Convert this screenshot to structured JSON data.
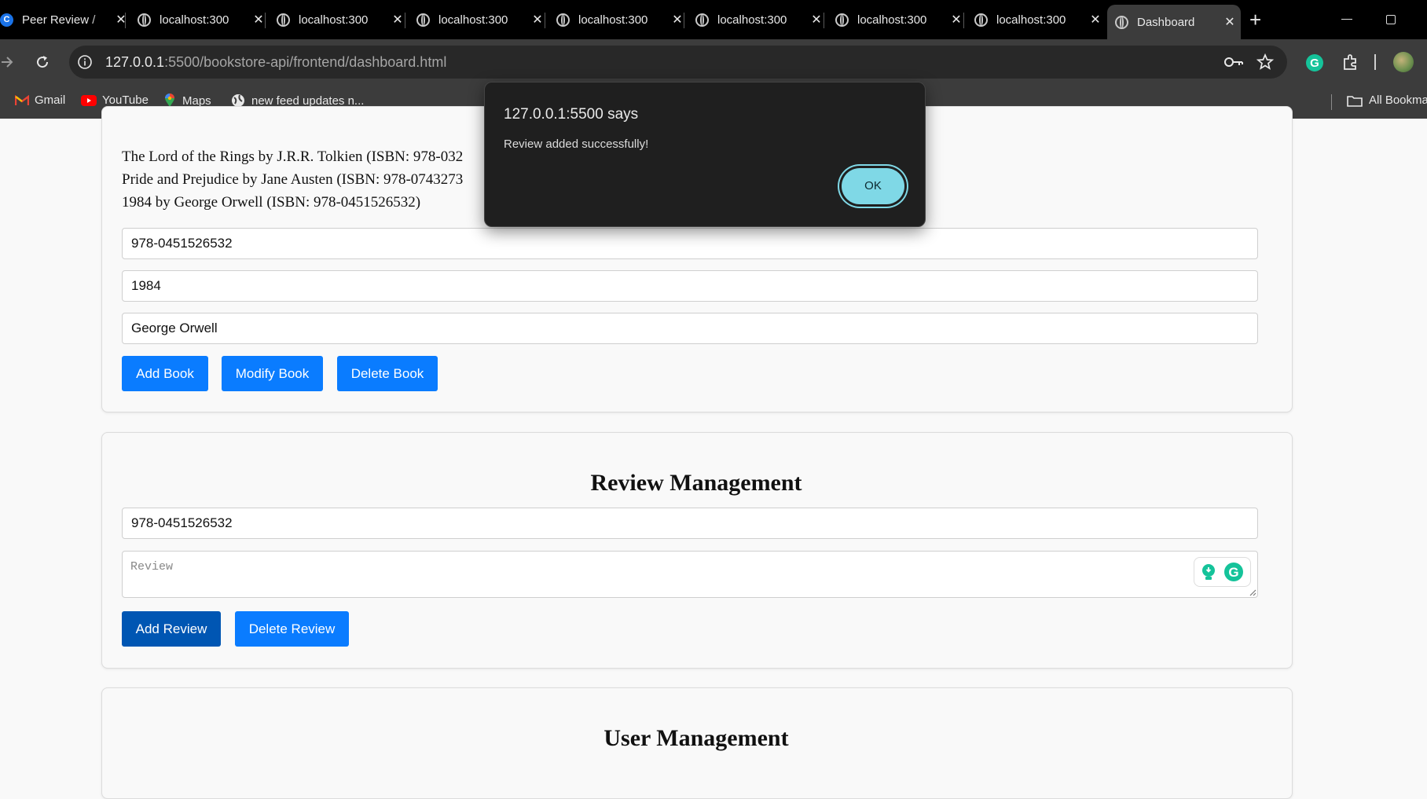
{
  "browser": {
    "tabs": [
      {
        "title": "Peer Review /",
        "favicon": "c-logo-icon",
        "active": false
      },
      {
        "title": "localhost:300",
        "favicon": "globe-icon",
        "active": false
      },
      {
        "title": "localhost:300",
        "favicon": "globe-icon",
        "active": false
      },
      {
        "title": "localhost:300",
        "favicon": "globe-icon",
        "active": false
      },
      {
        "title": "localhost:300",
        "favicon": "globe-icon",
        "active": false
      },
      {
        "title": "localhost:300",
        "favicon": "globe-icon",
        "active": false
      },
      {
        "title": "localhost:300",
        "favicon": "globe-icon",
        "active": false
      },
      {
        "title": "localhost:300",
        "favicon": "globe-icon",
        "active": false
      },
      {
        "title": "Dashboard",
        "favicon": "globe-icon",
        "active": true
      }
    ],
    "url_host": "127.0.0.1",
    "url_rest": ":5500/bookstore-api/frontend/dashboard.html",
    "bookmarks": [
      "Gmail",
      "YouTube",
      "Maps",
      "new feed updates n...",
      "All Bookma"
    ]
  },
  "books": {
    "list": [
      "The Lord of the Rings by J.R.R. Tolkien (ISBN: 978-032",
      "Pride and Prejudice by Jane Austen (ISBN: 978-0743273",
      "1984 by George Orwell (ISBN: 978-0451526532)"
    ],
    "isbn_value": "978-0451526532",
    "title_value": "1984",
    "author_value": "George Orwell",
    "add_label": "Add Book",
    "modify_label": "Modify Book",
    "delete_label": "Delete Book"
  },
  "reviews": {
    "heading": "Review Management",
    "isbn_value": "978-0451526532",
    "review_placeholder": "Review",
    "add_label": "Add Review",
    "delete_label": "Delete Review"
  },
  "users": {
    "heading": "User Management"
  },
  "dialog": {
    "title": "127.0.0.1:5500 says",
    "message": "Review added successfully!",
    "ok_label": "OK"
  },
  "colors": {
    "accent": "#0a7cff",
    "accent_dark": "#0056b3",
    "dialog_ok": "#7fd8e6"
  }
}
